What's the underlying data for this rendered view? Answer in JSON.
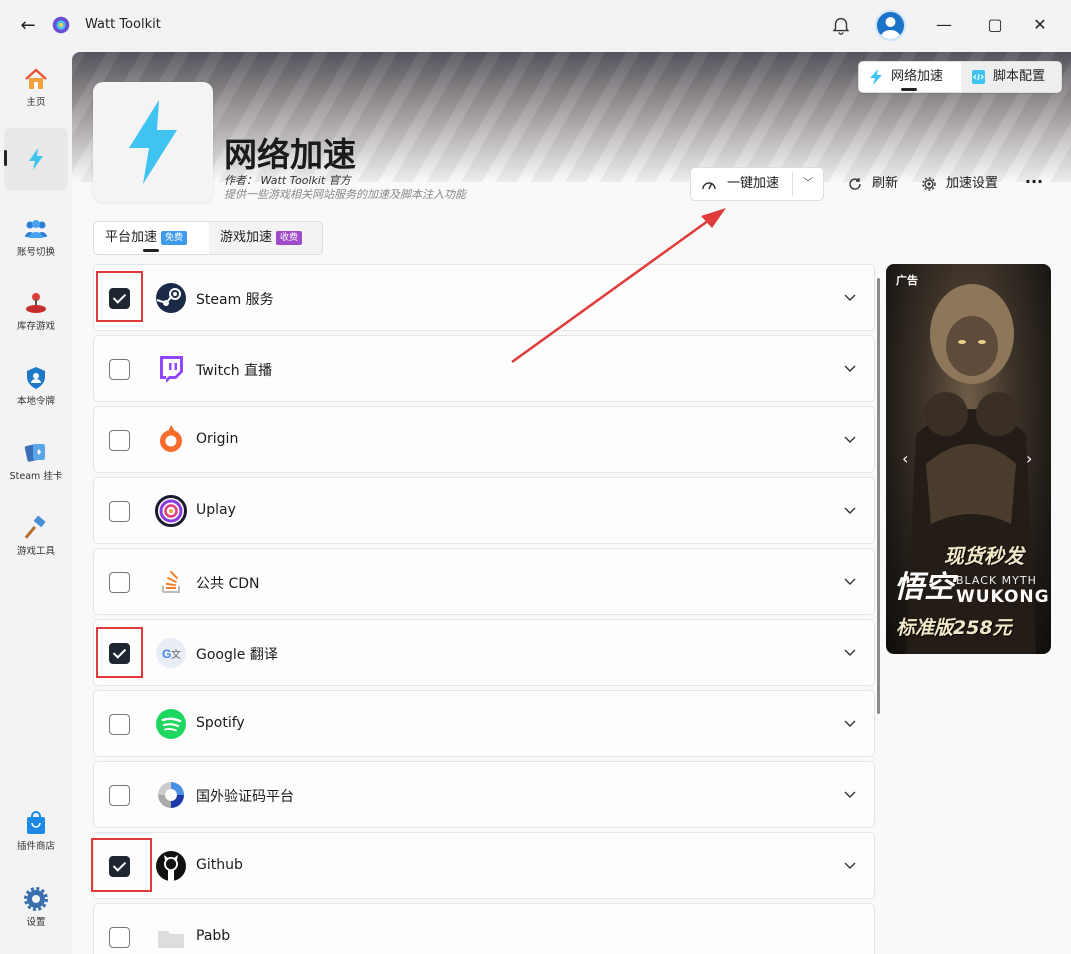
{
  "app": {
    "title": "Watt Toolkit"
  },
  "sidebar": {
    "items": [
      {
        "label": "主页",
        "icon": "home-icon"
      },
      {
        "label": "",
        "icon": "lightning-icon"
      },
      {
        "label": "账号切换",
        "icon": "users-icon"
      },
      {
        "label": "库存游戏",
        "icon": "joystick-icon"
      },
      {
        "label": "本地令牌",
        "icon": "shield-user-icon"
      },
      {
        "label": "Steam 挂卡",
        "icon": "cards-icon"
      },
      {
        "label": "游戏工具",
        "icon": "hammer-icon"
      },
      {
        "label": "插件商店",
        "icon": "shopping-bag-icon"
      },
      {
        "label": "设置",
        "icon": "gear-icon"
      }
    ]
  },
  "header": {
    "title": "网络加速",
    "author": "作者：  Watt Toolkit  官方",
    "description": "提供一些游戏相关网站服务的加速及脚本注入功能",
    "mode_tabs": [
      "网络加速",
      "脚本配置"
    ],
    "accelerate_label": "一键加速",
    "refresh_label": "刷新",
    "settings_label": "加速设置",
    "more_label": "···"
  },
  "tabs": [
    {
      "label": "平台加速",
      "badge": "免费"
    },
    {
      "label": "游戏加速",
      "badge": "收费"
    }
  ],
  "services": [
    {
      "name": "Steam 服务",
      "checked": true,
      "icon": "steam-icon"
    },
    {
      "name": "Twitch 直播",
      "checked": false,
      "icon": "twitch-icon"
    },
    {
      "name": "Origin",
      "checked": false,
      "icon": "origin-icon"
    },
    {
      "name": "Uplay",
      "checked": false,
      "icon": "uplay-icon"
    },
    {
      "name": "公共 CDN",
      "checked": false,
      "icon": "stack-icon"
    },
    {
      "name": "Google 翻译",
      "checked": true,
      "icon": "google-translate-icon"
    },
    {
      "name": "Spotify",
      "checked": false,
      "icon": "spotify-icon"
    },
    {
      "name": "国外验证码平台",
      "checked": false,
      "icon": "recaptcha-icon"
    },
    {
      "name": "Github",
      "checked": true,
      "icon": "github-icon"
    },
    {
      "name": "Pabb",
      "checked": false,
      "icon": "folder-icon"
    }
  ],
  "ad": {
    "label": "广告",
    "line1": "现货秒发",
    "line2": "BLACK MYTH",
    "line3": "WUKONG",
    "line4": "标准版258元",
    "logo_text": "悟空"
  },
  "colors": {
    "accent": "#1e2632",
    "highlight_red": "#e03a3a",
    "lightning": "#3fc3f0"
  }
}
